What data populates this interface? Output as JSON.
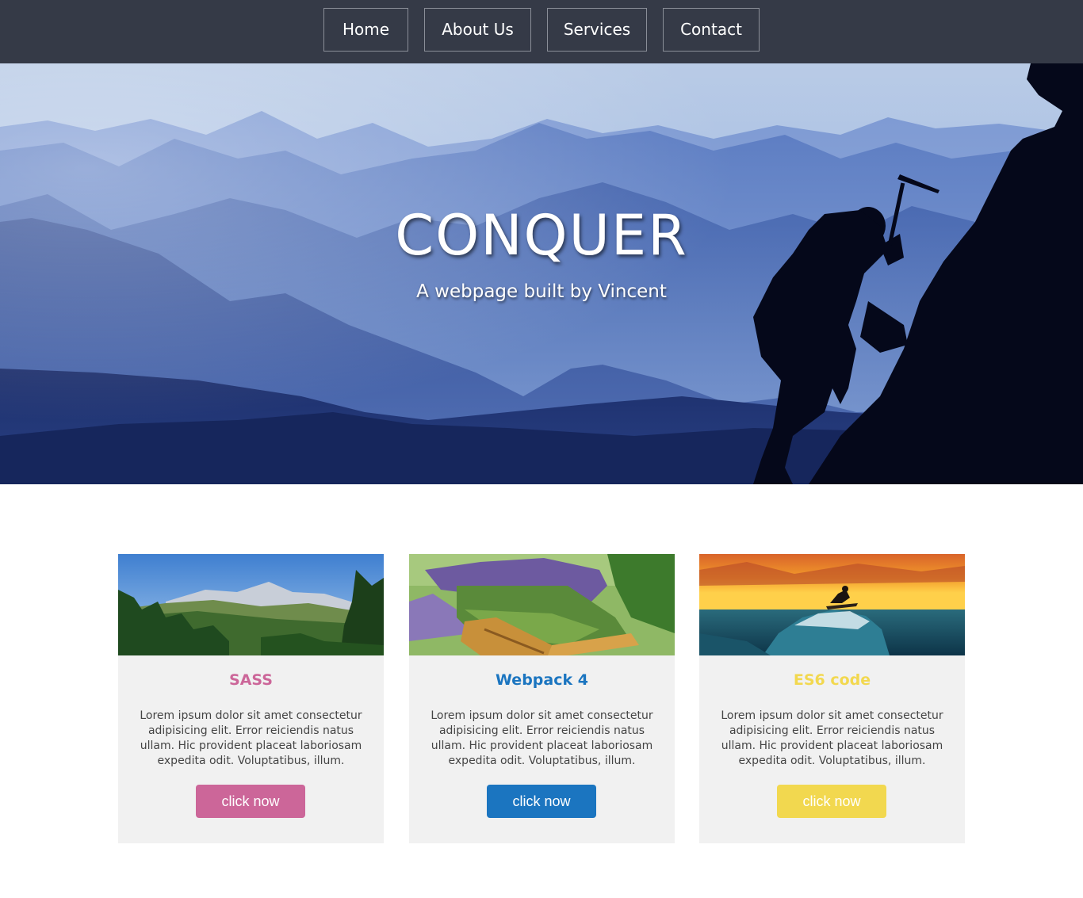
{
  "nav": {
    "items": [
      {
        "label": "Home"
      },
      {
        "label": "About Us"
      },
      {
        "label": "Services"
      },
      {
        "label": "Contact"
      }
    ]
  },
  "hero": {
    "title": "CONQUER",
    "subtitle": "A webpage built by Vincent"
  },
  "cards": [
    {
      "title": "SASS",
      "text": "Lorem ipsum dolor sit amet consectetur adipisicing elit. Error reiciendis natus ullam. Hic provident placeat laboriosam expedita odit. Voluptatibus, illum.",
      "button": "click now",
      "color": "#cc6699",
      "image": "mountain-landscape"
    },
    {
      "title": "Webpack 4",
      "text": "Lorem ipsum dolor sit amet consectetur adipisicing elit. Error reiciendis natus ullam. Hic provident placeat laboriosam expedita odit. Voluptatibus, illum.",
      "button": "click now",
      "color": "#1b75c0",
      "image": "lavender-crate"
    },
    {
      "title": "ES6 code",
      "text": "Lorem ipsum dolor sit amet consectetur adipisicing elit. Error reiciendis natus ullam. Hic provident placeat laboriosam expedita odit. Voluptatibus, illum.",
      "button": "click now",
      "color": "#f2d84f",
      "image": "surfer-sunset"
    }
  ]
}
